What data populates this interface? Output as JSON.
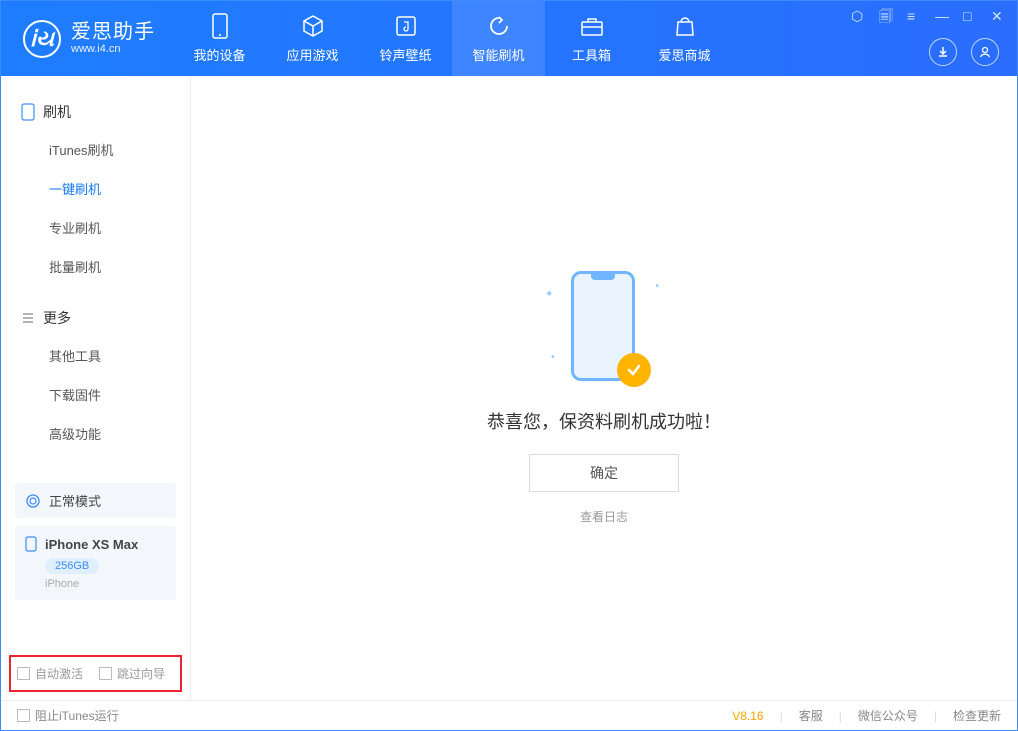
{
  "logo": {
    "title": "爱思助手",
    "sub": "www.i4.cn"
  },
  "nav": [
    {
      "label": "我的设备"
    },
    {
      "label": "应用游戏"
    },
    {
      "label": "铃声壁纸"
    },
    {
      "label": "智能刷机"
    },
    {
      "label": "工具箱"
    },
    {
      "label": "爱思商城"
    }
  ],
  "sidebar": {
    "section1": "刷机",
    "items1": [
      "iTunes刷机",
      "一键刷机",
      "专业刷机",
      "批量刷机"
    ],
    "section2": "更多",
    "items2": [
      "其他工具",
      "下载固件",
      "高级功能"
    ]
  },
  "device": {
    "status": "正常模式",
    "name": "iPhone XS Max",
    "capacity": "256GB",
    "type": "iPhone"
  },
  "checkboxes": {
    "auto_activate": "自动激活",
    "skip_guide": "跳过向导"
  },
  "main": {
    "success": "恭喜您，保资料刷机成功啦！",
    "ok": "确定",
    "view_log": "查看日志"
  },
  "footer": {
    "block_itunes": "阻止iTunes运行",
    "version": "V8.16",
    "support": "客服",
    "wechat": "微信公众号",
    "check_update": "检查更新"
  }
}
